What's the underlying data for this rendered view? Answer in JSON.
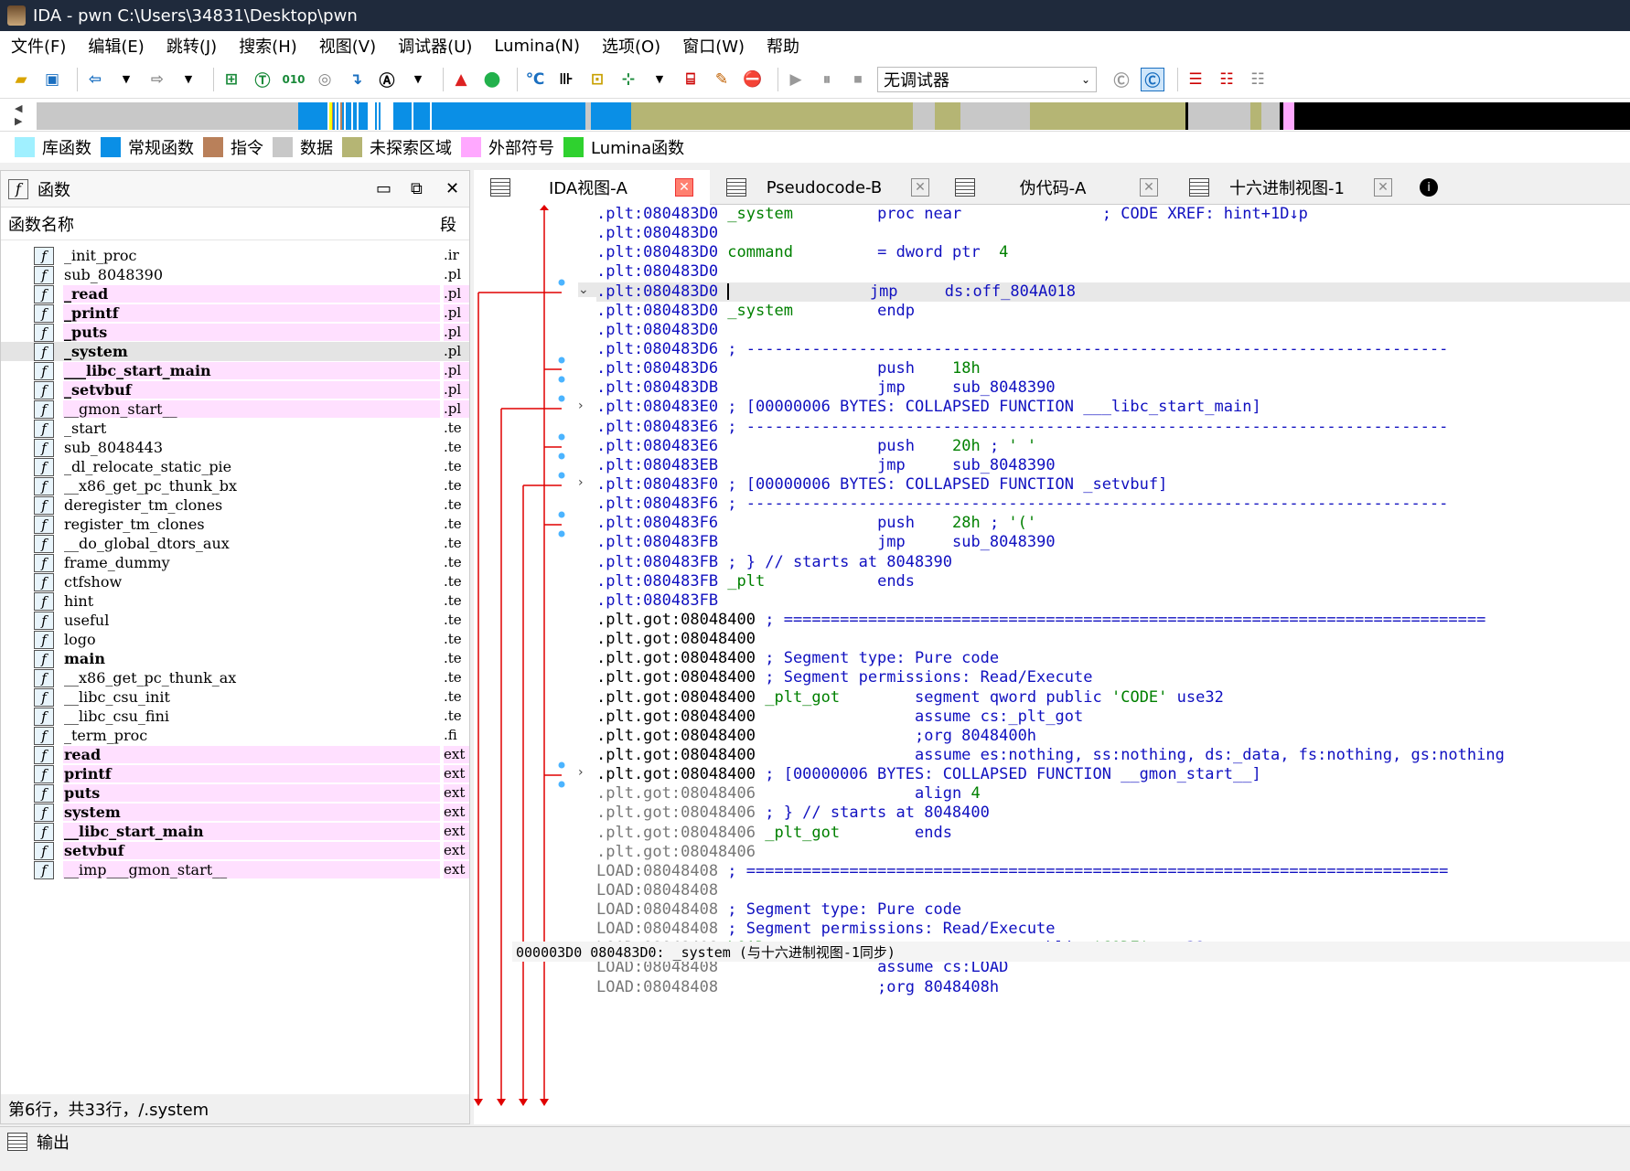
{
  "window": {
    "title": "IDA - pwn C:\\Users\\34831\\Desktop\\pwn"
  },
  "menu": [
    "文件(F)",
    "编辑(E)",
    "跳转(J)",
    "搜索(H)",
    "视图(V)",
    "调试器(U)",
    "Lumina(N)",
    "选项(O)",
    "窗口(W)",
    "帮助"
  ],
  "toolbar": {
    "debugger_select": "无调试器"
  },
  "legend": [
    {
      "label": "库函数",
      "color": "#a0f0ff"
    },
    {
      "label": "常规函数",
      "color": "#0a8fe6"
    },
    {
      "label": "指令",
      "color": "#b9805a"
    },
    {
      "label": "数据",
      "color": "#c8c8c8"
    },
    {
      "label": "未探索区域",
      "color": "#b5b574"
    },
    {
      "label": "外部符号",
      "color": "#ffa8ff"
    },
    {
      "label": "Lumina函数",
      "color": "#2fd12f"
    }
  ],
  "functions_panel": {
    "title": "函数",
    "col_name": "函数名称",
    "col_seg": "段",
    "status": "第6行，共33行，/.system",
    "items": [
      {
        "name": "_init_proc",
        "seg": ".ir",
        "style": "plain"
      },
      {
        "name": "sub_8048390",
        "seg": ".pl",
        "style": "plain"
      },
      {
        "name": "_read",
        "seg": ".pl",
        "style": "pinkbold"
      },
      {
        "name": "_printf",
        "seg": ".pl",
        "style": "pinkbold"
      },
      {
        "name": "_puts",
        "seg": ".pl",
        "style": "pinkbold"
      },
      {
        "name": "_system",
        "seg": ".pl",
        "style": "selbold"
      },
      {
        "name": "___libc_start_main",
        "seg": ".pl",
        "style": "pinkbold"
      },
      {
        "name": "_setvbuf",
        "seg": ".pl",
        "style": "pinkbold"
      },
      {
        "name": "__gmon_start__",
        "seg": ".pl",
        "style": "pink"
      },
      {
        "name": "_start",
        "seg": ".te",
        "style": "plain"
      },
      {
        "name": "sub_8048443",
        "seg": ".te",
        "style": "plain"
      },
      {
        "name": "_dl_relocate_static_pie",
        "seg": ".te",
        "style": "plain"
      },
      {
        "name": "__x86_get_pc_thunk_bx",
        "seg": ".te",
        "style": "plain"
      },
      {
        "name": "deregister_tm_clones",
        "seg": ".te",
        "style": "plain"
      },
      {
        "name": "register_tm_clones",
        "seg": ".te",
        "style": "plain"
      },
      {
        "name": "__do_global_dtors_aux",
        "seg": ".te",
        "style": "plain"
      },
      {
        "name": "frame_dummy",
        "seg": ".te",
        "style": "plain"
      },
      {
        "name": "ctfshow",
        "seg": ".te",
        "style": "plain"
      },
      {
        "name": "hint",
        "seg": ".te",
        "style": "plain"
      },
      {
        "name": "useful",
        "seg": ".te",
        "style": "plain"
      },
      {
        "name": "logo",
        "seg": ".te",
        "style": "plain"
      },
      {
        "name": "main",
        "seg": ".te",
        "style": "bold"
      },
      {
        "name": "__x86_get_pc_thunk_ax",
        "seg": ".te",
        "style": "plain"
      },
      {
        "name": "__libc_csu_init",
        "seg": ".te",
        "style": "plain"
      },
      {
        "name": "__libc_csu_fini",
        "seg": ".te",
        "style": "plain"
      },
      {
        "name": "_term_proc",
        "seg": ".fi",
        "style": "plain"
      },
      {
        "name": "read",
        "seg": "ext",
        "style": "pinkbold"
      },
      {
        "name": "printf",
        "seg": "ext",
        "style": "pinkbold"
      },
      {
        "name": "puts",
        "seg": "ext",
        "style": "pinkbold"
      },
      {
        "name": "system",
        "seg": "ext",
        "style": "pinkbold"
      },
      {
        "name": "__libc_start_main",
        "seg": "ext",
        "style": "pinkbold"
      },
      {
        "name": "setvbuf",
        "seg": "ext",
        "style": "pinkbold"
      },
      {
        "name": "__imp___gmon_start__",
        "seg": "ext",
        "style": "pink"
      }
    ]
  },
  "tabs": [
    {
      "label": "IDA视图-A",
      "active": true
    },
    {
      "label": "Pseudocode-B",
      "active": false
    },
    {
      "label": "伪代码-A",
      "active": false
    },
    {
      "label": "十六进制视图-1",
      "active": false
    }
  ],
  "disasm": [
    [
      ".plt:080483D0 ",
      "_system",
      "         proc near               ; CODE XREF: hint+1D↓p"
    ],
    [
      ".plt:080483D0",
      "",
      " "
    ],
    [
      ".plt:080483D0 ",
      "command",
      "         = dword ptr  4"
    ],
    [
      ".plt:080483D0",
      "",
      " "
    ],
    [
      ".plt:080483D0 ",
      "",
      "                jmp     ds:off_804A018"
    ],
    [
      ".plt:080483D0 ",
      "_system",
      "         endp"
    ],
    [
      ".plt:080483D0",
      "",
      " "
    ],
    [
      ".plt:080483D6 ",
      "",
      "; ---------------------------------------------------------------------------"
    ],
    [
      ".plt:080483D6 ",
      "",
      "                push    18h"
    ],
    [
      ".plt:080483DB ",
      "",
      "                jmp     sub_8048390"
    ],
    [
      ".plt:080483E0 ",
      "",
      "; [00000006 BYTES: COLLAPSED FUNCTION ___libc_start_main]"
    ],
    [
      ".plt:080483E6 ",
      "",
      "; ---------------------------------------------------------------------------"
    ],
    [
      ".plt:080483E6 ",
      "",
      "                push    20h ; ' '"
    ],
    [
      ".plt:080483EB ",
      "",
      "                jmp     sub_8048390"
    ],
    [
      ".plt:080483F0 ",
      "",
      "; [00000006 BYTES: COLLAPSED FUNCTION _setvbuf]"
    ],
    [
      ".plt:080483F6 ",
      "",
      "; ---------------------------------------------------------------------------"
    ],
    [
      ".plt:080483F6 ",
      "",
      "                push    28h ; '('"
    ],
    [
      ".plt:080483FB ",
      "",
      "                jmp     sub_8048390"
    ],
    [
      ".plt:080483FB ",
      "",
      "; } // starts at 8048390"
    ],
    [
      ".plt:080483FB ",
      "_plt",
      "            ends"
    ],
    [
      ".plt:080483FB",
      "",
      " "
    ],
    [
      ".plt.got:08048400 ",
      "",
      "; ==========================================================================="
    ],
    [
      ".plt.got:08048400",
      "",
      " "
    ],
    [
      ".plt.got:08048400 ",
      "",
      "; Segment type: Pure code"
    ],
    [
      ".plt.got:08048400 ",
      "",
      "; Segment permissions: Read/Execute"
    ],
    [
      ".plt.got:08048400 ",
      "_plt_got",
      "        segment qword public 'CODE' use32"
    ],
    [
      ".plt.got:08048400 ",
      "",
      "                assume cs:_plt_got"
    ],
    [
      ".plt.got:08048400 ",
      "",
      "                ;org 8048400h"
    ],
    [
      ".plt.got:08048400 ",
      "",
      "                assume es:nothing, ss:nothing, ds:_data, fs:nothing, gs:nothing"
    ],
    [
      ".plt.got:08048400 ",
      "",
      "; [00000006 BYTES: COLLAPSED FUNCTION __gmon_start__]"
    ],
    [
      ".plt.got:08048406 ",
      "",
      "                align 4"
    ],
    [
      ".plt.got:08048406 ",
      "",
      "; } // starts at 8048400"
    ],
    [
      ".plt.got:08048406 ",
      "_plt_got",
      "        ends"
    ],
    [
      ".plt.got:08048406",
      "",
      " "
    ],
    [
      "LOAD:08048408 ",
      "",
      "; ==========================================================================="
    ],
    [
      "LOAD:08048408",
      "",
      " "
    ],
    [
      "LOAD:08048408 ",
      "",
      "; Segment type: Pure code"
    ],
    [
      "LOAD:08048408 ",
      "",
      "; Segment permissions: Read/Execute"
    ],
    [
      "LOAD:08048408 ",
      "LOAD",
      "            segment mempage public 'CODE' use32"
    ],
    [
      "LOAD:08048408 ",
      "",
      "                assume cs:LOAD"
    ],
    [
      "LOAD:08048408 ",
      "",
      "                ;org 8048408h"
    ]
  ],
  "addr_status": "000003D0  080483D0: _system  (与十六进制视图-1同步)",
  "output": {
    "label": "输出"
  }
}
